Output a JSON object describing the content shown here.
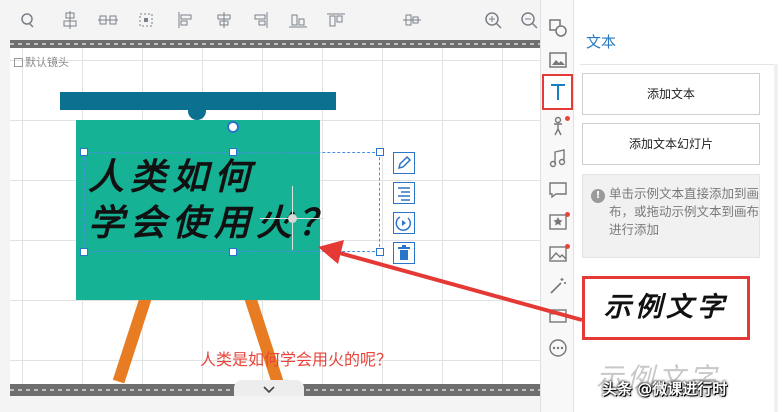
{
  "canvas": {
    "camera_label": "默认镜头",
    "board_line1": "人类如何",
    "board_line2": "学会使用火？",
    "caption": "人类是如何学会用火的呢？"
  },
  "toolbar": {
    "icons": [
      "lasso-icon",
      "align-top-icon",
      "align-vcenter-icon",
      "distribute-icon",
      "align-left-icon",
      "align-hcenter-icon",
      "align-right-icon",
      "align-bottom-icon",
      "align-middle-icon",
      "align-base-icon",
      "zoom-in-icon",
      "zoom-out-icon"
    ]
  },
  "side_tools": [
    "edit-icon",
    "align-text-icon",
    "animation-icon",
    "trash-icon"
  ],
  "icon_column": [
    "shape-icon",
    "image-icon",
    "text-icon",
    "character-icon",
    "music-icon",
    "comment-icon",
    "star-shape-icon",
    "photo-icon",
    "magic-wand-icon",
    "film-icon",
    "more-icon"
  ],
  "panel": {
    "title": "文本",
    "add_text": "添加文本",
    "add_text_slide": "添加文本幻灯片",
    "hint": "单击示例文本直接添加到画布，或拖动示例文本到画布进行添加",
    "sample_text": "示例文字",
    "sample_text_2": "示例文字"
  },
  "watermark": "头条 @微课进行时",
  "colors": {
    "board": "#16b295",
    "easel_top": "#0c7191",
    "legs": "#e87c23",
    "accent_blue": "#2a7bc0",
    "highlight_red": "#e53935",
    "caption_red": "#e8453c"
  }
}
